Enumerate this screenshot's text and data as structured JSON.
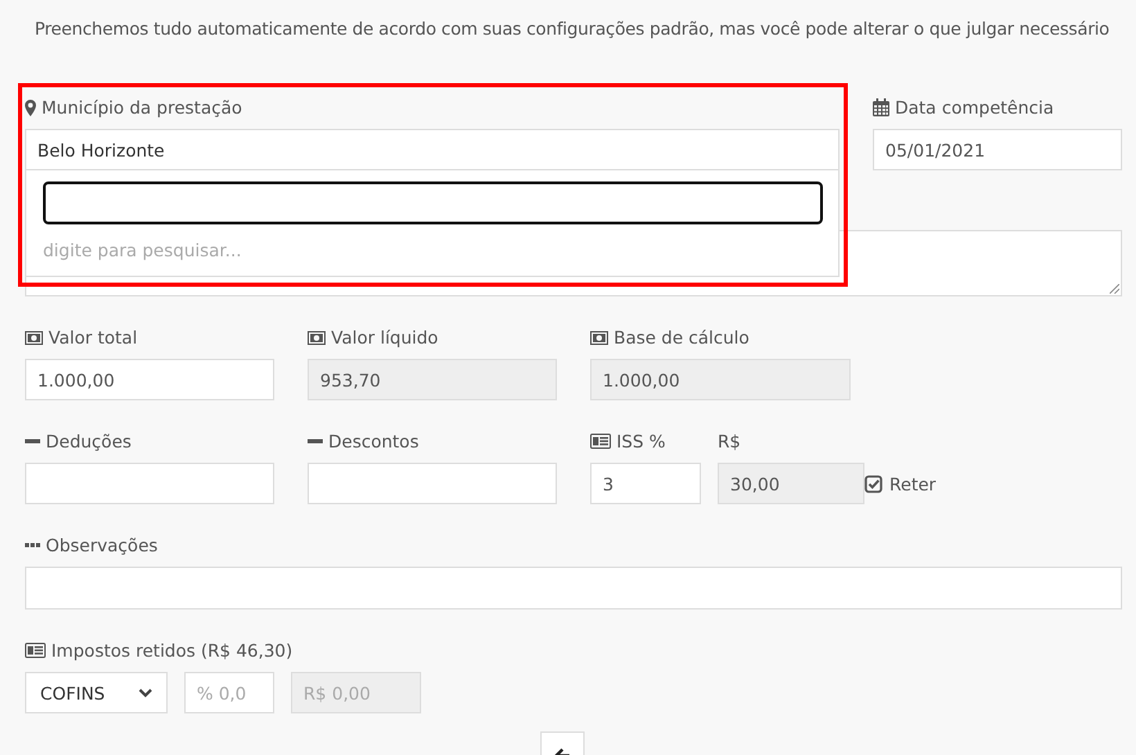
{
  "intro": "Preenchemos tudo automaticamente de acordo com suas configurações padrão, mas você pode alterar o que julgar necessário",
  "municipio": {
    "label": "Município da prestação",
    "value": "Belo Horizonte",
    "search_hint": "digite para pesquisar...",
    "open": true
  },
  "data_competencia": {
    "label": "Data competência",
    "value": "05/01/2021"
  },
  "valores": [
    {
      "label": "Valor total",
      "value": "1.000,00",
      "disabled": false
    },
    {
      "label": "Valor líquido",
      "value": "953,70",
      "disabled": true
    },
    {
      "label": "Base de cálculo",
      "value": "1.000,00",
      "disabled": true
    }
  ],
  "ajustes": [
    {
      "label": "Deduções"
    },
    {
      "label": "Descontos"
    }
  ],
  "iss": {
    "label": "ISS %",
    "value": "3",
    "amount_label": "R$",
    "amount": "30,00",
    "retain_label": "Reter",
    "retain_checked": true
  },
  "observacoes": {
    "label": "Observações"
  },
  "impostos": {
    "label": "Impostos retidos (R$ 46,30)",
    "tax": "COFINS",
    "percent_placeholder": "% 0,0",
    "amount_placeholder": "R$ 0,00"
  }
}
